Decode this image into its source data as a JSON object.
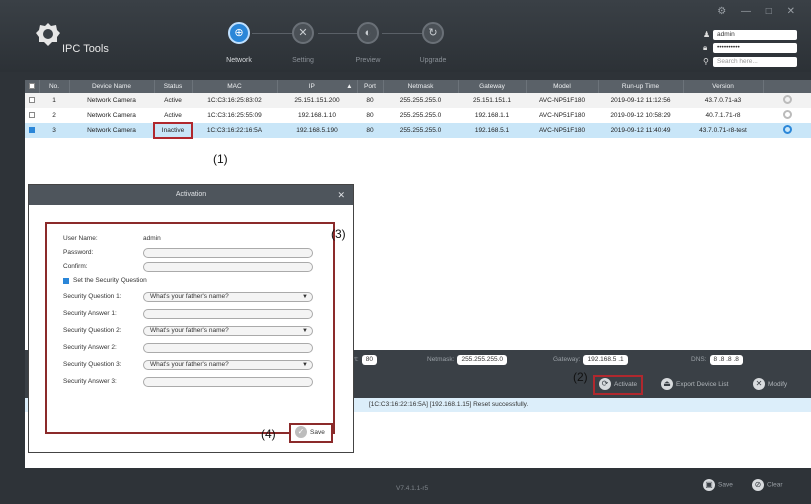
{
  "app": {
    "title": "IPC Tools",
    "window_controls": "⚙ — □ ✕"
  },
  "steps": [
    {
      "label": "Network",
      "icon": "network-icon",
      "glyph": "⊕",
      "active": true
    },
    {
      "label": "Setting",
      "icon": "setting-icon",
      "glyph": "✕",
      "active": false
    },
    {
      "label": "Preview",
      "icon": "preview-icon",
      "glyph": "◐",
      "active": false
    },
    {
      "label": "Upgrade",
      "icon": "upgrade-icon",
      "glyph": "↻",
      "active": false
    }
  ],
  "account": {
    "username": "admin",
    "password": "••••••••••",
    "search_placeholder": "Search here..."
  },
  "table": {
    "headers": [
      "No.",
      "Device Name",
      "Status",
      "MAC",
      "IP",
      "Port",
      "Netmask",
      "Gateway",
      "Model",
      "Run-up Time",
      "Version"
    ],
    "rows": [
      {
        "no": "1",
        "name": "Network Camera",
        "status": "Active",
        "mac": "1C:C3:16:25:83:02",
        "ip": "25.151.151.200",
        "port": "80",
        "netmask": "255.255.255.0",
        "gateway": "25.151.151.1",
        "model": "AVC-NP51F180",
        "runup": "2019-09-12 11:12:56",
        "version": "43.7.0.71-a3"
      },
      {
        "no": "2",
        "name": "Network Camera",
        "status": "Active",
        "mac": "1C:C3:16:25:55:09",
        "ip": "192.168.1.10",
        "port": "80",
        "netmask": "255.255.255.0",
        "gateway": "192.168.1.1",
        "model": "AVC-NP51F180",
        "runup": "2019-09-12 10:58:29",
        "version": "40.7.1.71-r8"
      },
      {
        "no": "3",
        "name": "Network Camera",
        "status": "Inactive",
        "mac": "1C:C3:16:22:16:5A",
        "ip": "192.168.5.190",
        "port": "80",
        "netmask": "255.255.255.0",
        "gateway": "192.168.5.1",
        "model": "AVC-NP51F180",
        "runup": "2019-09-12 11:40:49",
        "version": "43.7.0.71-r8-test"
      }
    ]
  },
  "params": {
    "port_label": "Port:",
    "port": "80",
    "netmask_label": "Netmask:",
    "netmask": "255.255.255.0",
    "gateway_label": "Gateway:",
    "gateway": "192.168.5 .1",
    "dns_label": "DNS:",
    "dns": "8 .8 .8 .8"
  },
  "actions": {
    "activate": "Activate",
    "export": "Export Device List",
    "modify": "Modify"
  },
  "log": {
    "message": "[1C:C3:16:22:16:5A] [192.168.1.15] Reset successfully."
  },
  "footer": {
    "version": "V7.4.1.1-r5",
    "save": "Save",
    "clear": "Clear"
  },
  "dialog": {
    "title": "Activation",
    "username_label": "User Name:",
    "username": "admin",
    "password_label": "Password:",
    "confirm_label": "Confirm:",
    "security_toggle": "Set the Security Question",
    "q1_label": "Security Question 1:",
    "q1": "What's your father's name?",
    "a1_label": "Security Answer 1:",
    "q2_label": "Security Question 2:",
    "q2": "What's your father's name?",
    "a2_label": "Security Answer 2:",
    "q3_label": "Security Question 3:",
    "q3": "What's your father's name?",
    "a3_label": "Security Answer 3:",
    "save": "Save"
  },
  "callouts": {
    "c1": "(1)",
    "c2": "(2)",
    "c3": "(3)",
    "c4": "(4)"
  }
}
